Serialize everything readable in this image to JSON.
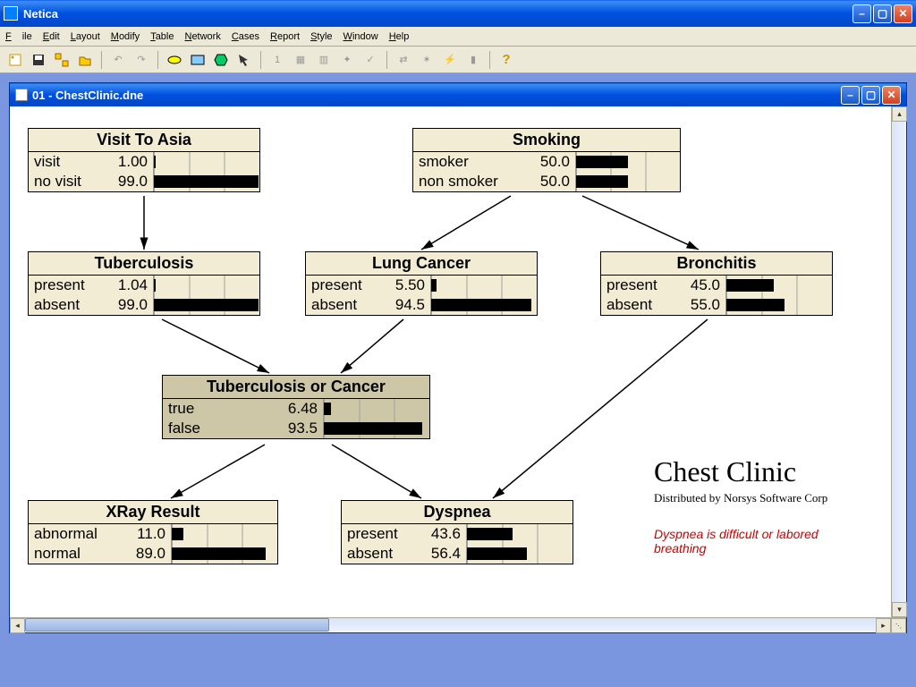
{
  "app": {
    "title": "Netica"
  },
  "menu": {
    "file": "File",
    "edit": "Edit",
    "layout": "Layout",
    "modify": "Modify",
    "table": "Table",
    "network": "Network",
    "cases": "Cases",
    "report": "Report",
    "style": "Style",
    "window": "Window",
    "help": "Help"
  },
  "toolbar": {
    "one_label": "1"
  },
  "document": {
    "title": "01 - ChestClinic.dne"
  },
  "annotations": {
    "title": "Chest Clinic",
    "subtitle": "Distributed by Norsys Software Corp",
    "red_note": "Dyspnea is difficult or labored breathing"
  },
  "nodes": {
    "visit_asia": {
      "title": "Visit To Asia",
      "states": [
        {
          "label": "visit",
          "value": "1.00",
          "pct": 1.0
        },
        {
          "label": "no visit",
          "value": "99.0",
          "pct": 99.0
        }
      ]
    },
    "smoking": {
      "title": "Smoking",
      "states": [
        {
          "label": "smoker",
          "value": "50.0",
          "pct": 50.0
        },
        {
          "label": "non smoker",
          "value": "50.0",
          "pct": 50.0
        }
      ]
    },
    "tuberculosis": {
      "title": "Tuberculosis",
      "states": [
        {
          "label": "present",
          "value": "1.04",
          "pct": 1.04
        },
        {
          "label": "absent",
          "value": "99.0",
          "pct": 99.0
        }
      ]
    },
    "lung_cancer": {
      "title": "Lung Cancer",
      "states": [
        {
          "label": "present",
          "value": "5.50",
          "pct": 5.5
        },
        {
          "label": "absent",
          "value": "94.5",
          "pct": 94.5
        }
      ]
    },
    "bronchitis": {
      "title": "Bronchitis",
      "states": [
        {
          "label": "present",
          "value": "45.0",
          "pct": 45.0
        },
        {
          "label": "absent",
          "value": "55.0",
          "pct": 55.0
        }
      ]
    },
    "tb_or_cancer": {
      "title": "Tuberculosis or Cancer",
      "states": [
        {
          "label": "true",
          "value": "6.48",
          "pct": 6.48
        },
        {
          "label": "false",
          "value": "93.5",
          "pct": 93.5
        }
      ]
    },
    "xray": {
      "title": "XRay Result",
      "states": [
        {
          "label": "abnormal",
          "value": "11.0",
          "pct": 11.0
        },
        {
          "label": "normal",
          "value": "89.0",
          "pct": 89.0
        }
      ]
    },
    "dyspnea": {
      "title": "Dyspnea",
      "states": [
        {
          "label": "present",
          "value": "43.6",
          "pct": 43.6
        },
        {
          "label": "absent",
          "value": "56.4",
          "pct": 56.4
        }
      ]
    }
  }
}
